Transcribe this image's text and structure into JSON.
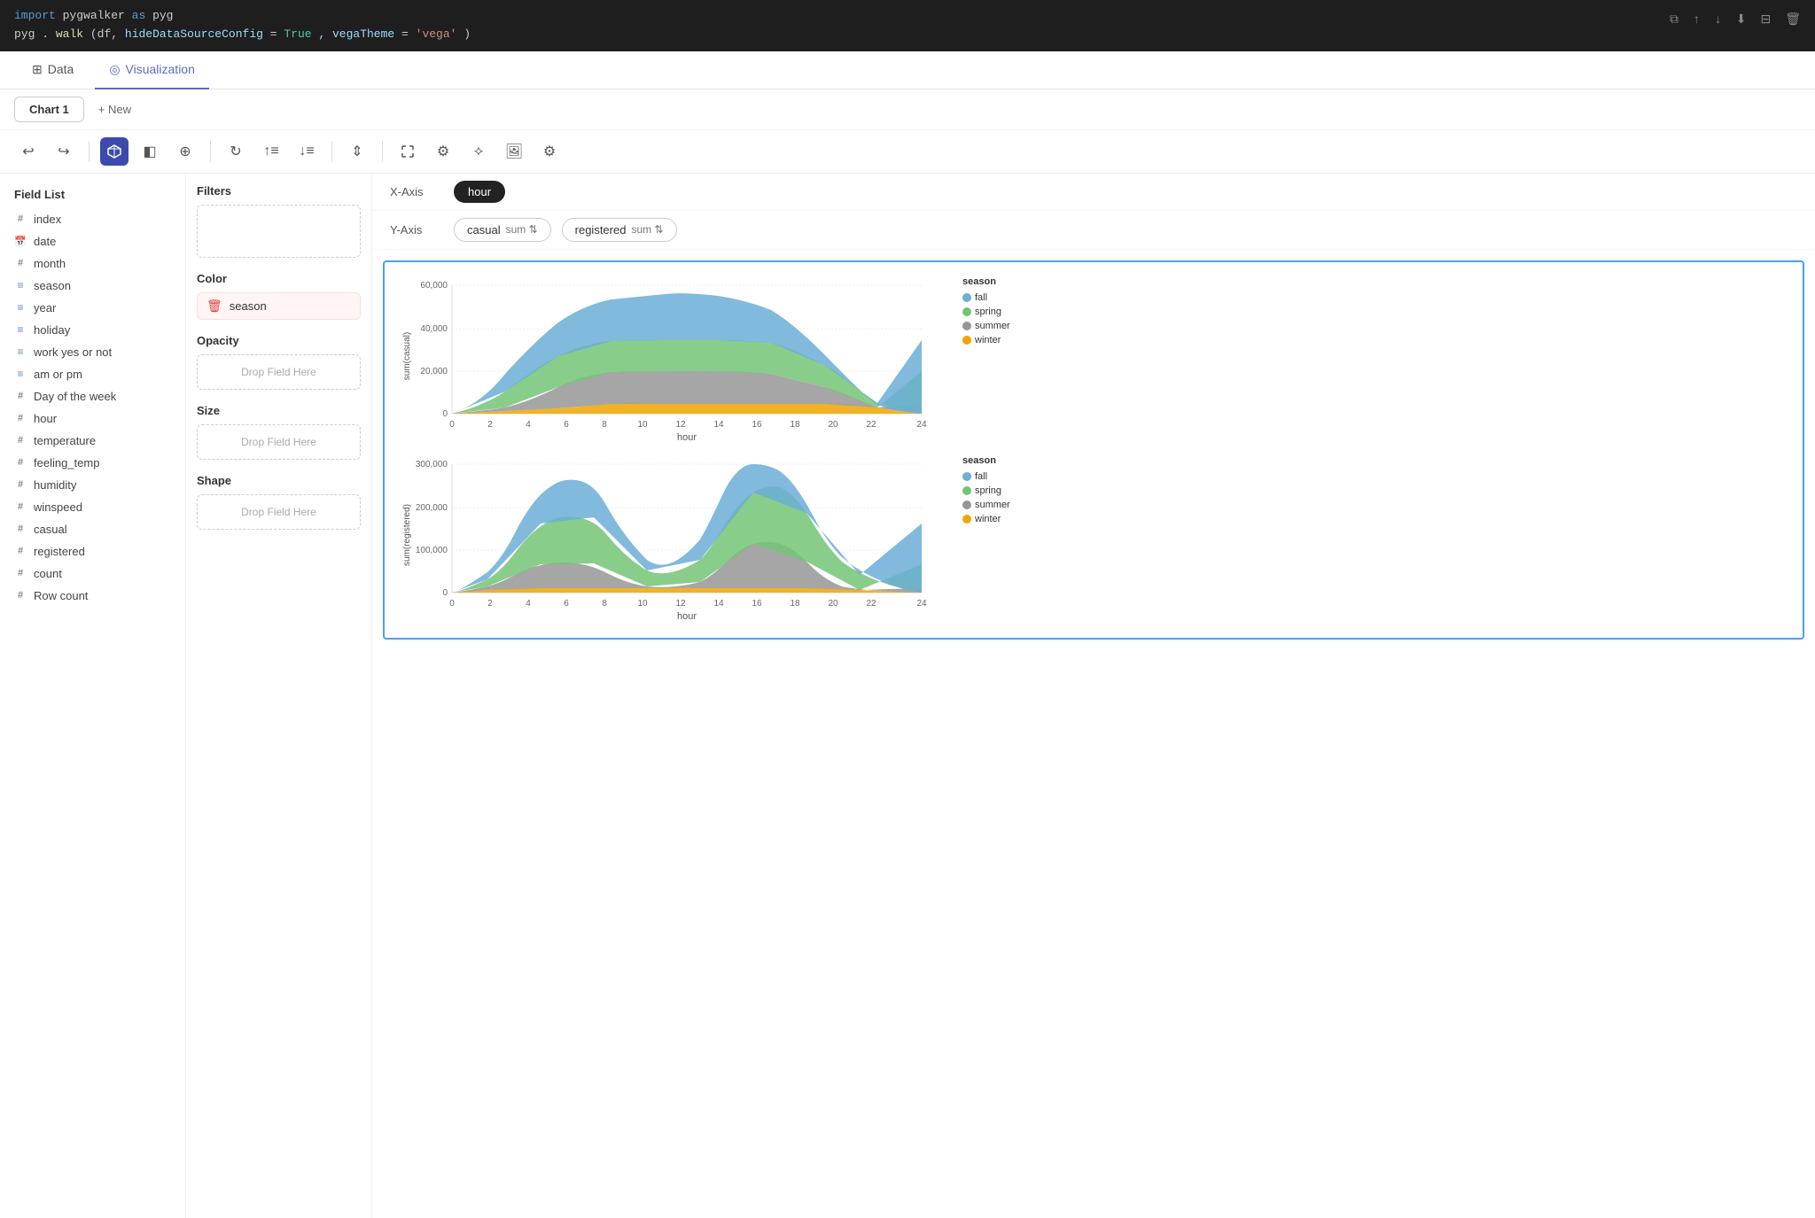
{
  "code": {
    "line1_import": "import",
    "line1_module": "pygwalker",
    "line1_as": "as",
    "line1_alias": "pyg",
    "line2_obj": "pyg",
    "line2_method": "walk",
    "line2_arg1": "df",
    "line2_param1": "hideDataSourceConfig",
    "line2_val1": "True",
    "line2_param2": "vegaTheme",
    "line2_val2": "'vega'"
  },
  "topbar_icons": [
    "copy",
    "up",
    "down",
    "download",
    "split",
    "trash"
  ],
  "tabs": [
    {
      "id": "data",
      "label": "Data",
      "icon": "⊞",
      "active": false
    },
    {
      "id": "visualization",
      "label": "Visualization",
      "icon": "◎",
      "active": true
    }
  ],
  "chart_tabs": [
    {
      "label": "Chart 1",
      "active": true
    },
    {
      "label": "+ New",
      "active": false
    }
  ],
  "toolbar": {
    "undo_label": "↩",
    "redo_label": "↪",
    "view3d_label": "⬡",
    "mark_label": "◧",
    "layers_label": "⊕",
    "refresh_label": "↻",
    "sort_asc_label": "↑≡",
    "sort_desc_label": "↓≡",
    "stack_label": "⇕",
    "expand_label": "⤢",
    "settings2_label": "⚙",
    "connect_label": "⟡",
    "image_label": "🖼",
    "gear_label": "⚙"
  },
  "field_list": {
    "title": "Field List",
    "fields": [
      {
        "name": "index",
        "type": "num"
      },
      {
        "name": "date",
        "type": "date"
      },
      {
        "name": "month",
        "type": "num"
      },
      {
        "name": "season",
        "type": "str"
      },
      {
        "name": "year",
        "type": "str"
      },
      {
        "name": "holiday",
        "type": "str"
      },
      {
        "name": "work yes or not",
        "type": "str"
      },
      {
        "name": "am or pm",
        "type": "str"
      },
      {
        "name": "Day of the week",
        "type": "num"
      },
      {
        "name": "hour",
        "type": "num"
      },
      {
        "name": "temperature",
        "type": "num"
      },
      {
        "name": "feeling_temp",
        "type": "num"
      },
      {
        "name": "humidity",
        "type": "num"
      },
      {
        "name": "winspeed",
        "type": "num"
      },
      {
        "name": "casual",
        "type": "num"
      },
      {
        "name": "registered",
        "type": "num"
      },
      {
        "name": "count",
        "type": "num"
      },
      {
        "name": "Row count",
        "type": "num"
      }
    ]
  },
  "filters": {
    "title": "Filters",
    "drop_placeholder": ""
  },
  "color": {
    "title": "Color",
    "value": "season"
  },
  "opacity": {
    "title": "Opacity",
    "drop_placeholder": "Drop Field Here"
  },
  "size": {
    "title": "Size",
    "drop_placeholder": "Drop Field Here"
  },
  "shape": {
    "title": "Shape",
    "drop_placeholder": "Drop Field Here"
  },
  "x_axis": {
    "label": "X-Axis",
    "value": "hour"
  },
  "y_axis": {
    "label": "Y-Axis",
    "fields": [
      {
        "name": "casual",
        "agg": "sum"
      },
      {
        "name": "registered",
        "agg": "sum"
      }
    ]
  },
  "chart1": {
    "title": "sum(casual)",
    "x_label": "hour",
    "y_label": "sum(casual)",
    "y_max": 60000,
    "y_ticks": [
      0,
      20000,
      40000,
      60000
    ],
    "x_ticks": [
      0,
      2,
      4,
      6,
      8,
      10,
      12,
      14,
      16,
      18,
      20,
      22,
      24
    ],
    "legend": {
      "title": "season",
      "items": [
        {
          "label": "fall",
          "color": "#6baed6"
        },
        {
          "label": "spring",
          "color": "#74c476"
        },
        {
          "label": "summer",
          "color": "#969696"
        },
        {
          "label": "winter",
          "color": "#f0a500"
        }
      ]
    }
  },
  "chart2": {
    "title": "sum(registered)",
    "x_label": "hour",
    "y_label": "sum(registered)",
    "y_max": 300000,
    "y_ticks": [
      0,
      100000,
      200000,
      300000
    ],
    "x_ticks": [
      0,
      2,
      4,
      6,
      8,
      10,
      12,
      14,
      16,
      18,
      20,
      22,
      24
    ],
    "legend": {
      "title": "season",
      "items": [
        {
          "label": "fall",
          "color": "#6baed6"
        },
        {
          "label": "spring",
          "color": "#74c476"
        },
        {
          "label": "summer",
          "color": "#969696"
        },
        {
          "label": "winter",
          "color": "#f0a500"
        }
      ]
    }
  }
}
